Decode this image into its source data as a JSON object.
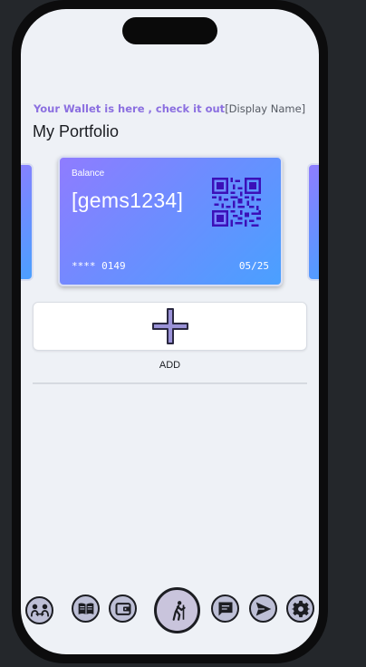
{
  "header": {
    "tagline": "Your Wallet is here , check it out",
    "display_name": "[Display Name]"
  },
  "portfolio_title": "My Portfolio",
  "card": {
    "balance_label": "Balance",
    "balance_value": "[gems1234]",
    "masked_number": "**** 0149",
    "expiry": "05/25"
  },
  "add_label": "ADD",
  "nav": [
    {
      "icon": "users-exchange-icon"
    },
    {
      "icon": "book-icon"
    },
    {
      "icon": "wallet-icon"
    },
    {
      "icon": "walking-person-icon"
    },
    {
      "icon": "chat-icon"
    },
    {
      "icon": "send-icon"
    },
    {
      "icon": "gear-icon"
    }
  ],
  "colors": {
    "accent": "#8b6fe0",
    "card_start": "#8f7cff",
    "card_end": "#4aa0ff",
    "nav_button": "#bdbfd6"
  }
}
